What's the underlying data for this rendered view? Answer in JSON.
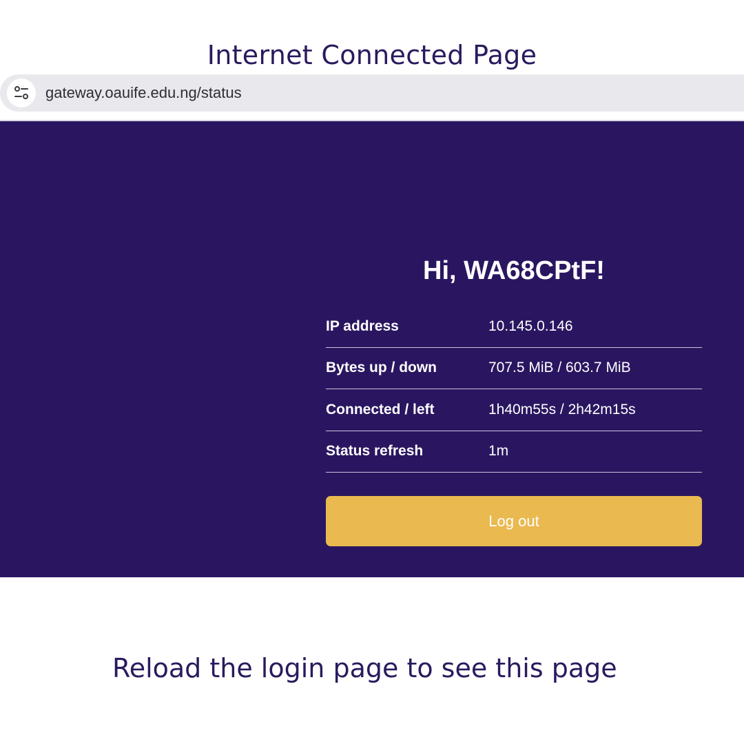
{
  "heading": "Internet Connected Page",
  "browser": {
    "url": "gateway.oauife.edu.ng/status",
    "site_info_icon": "tune-icon"
  },
  "status": {
    "greeting": "Hi, WA68CPtF!",
    "rows": [
      {
        "label": "IP address",
        "value": "10.145.0.146"
      },
      {
        "label": "Bytes up / down",
        "value": "707.5 MiB / 603.7 MiB"
      },
      {
        "label": "Connected / left",
        "value": "1h40m55s / 2h42m15s"
      },
      {
        "label": "Status refresh",
        "value": "1m"
      }
    ],
    "logout_label": "Log out"
  },
  "caption": "Reload the login page to see this page",
  "colors": {
    "panel_bg": "#2a1660",
    "button_bg": "#eab950",
    "heading_text": "#2a1a5e",
    "url_bar_bg": "#e9e8ed"
  }
}
